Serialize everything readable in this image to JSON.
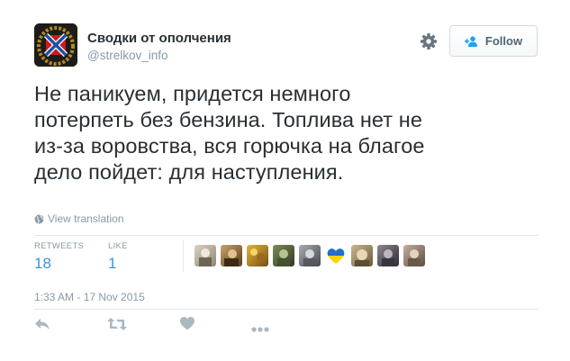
{
  "account": {
    "name": "Сводки от ополчения",
    "handle": "@strelkov_info"
  },
  "header": {
    "settings_icon": "gear-icon",
    "follow_label": "Follow",
    "follow_icon": "add-user-icon"
  },
  "tweet": {
    "lines": [
      "Не паникуем, придется немного",
      "потерпеть без бензина. Топлива нет не",
      "из-за воровства, вся горючка на благое",
      "дело пойдет: для наступления."
    ],
    "translate_label": "View translation",
    "translate_icon": "globe-icon"
  },
  "stats": {
    "retweets_label": "RETWEETS",
    "retweets_value": "18",
    "likes_label": "LIKE",
    "likes_value": "1"
  },
  "likers": [
    {
      "name": "liker-avatar-1",
      "color": "#b5ad9c"
    },
    {
      "name": "liker-avatar-2",
      "color": "#8a6b3d"
    },
    {
      "name": "liker-avatar-3",
      "color": "#c49a2c"
    },
    {
      "name": "liker-avatar-4",
      "color": "#5e6e3f"
    },
    {
      "name": "liker-avatar-5",
      "color": "#7b7f83"
    },
    {
      "name": "liker-avatar-6-heart",
      "color": "#ffffff"
    },
    {
      "name": "liker-avatar-7",
      "color": "#a08e6a"
    },
    {
      "name": "liker-avatar-8",
      "color": "#6f6a70"
    },
    {
      "name": "liker-avatar-9",
      "color": "#9c8a78"
    }
  ],
  "timestamp": "1:33 AM - 17 Nov 2015",
  "actions": [
    "reply-icon",
    "retweet-icon",
    "like-icon",
    "more-icon"
  ],
  "colors": {
    "link_blue": "#3b94d9",
    "muted_gray": "#8899a6",
    "text_dark": "#292f33",
    "divider": "#e1e8ed",
    "action_gray": "#aab8c2"
  }
}
